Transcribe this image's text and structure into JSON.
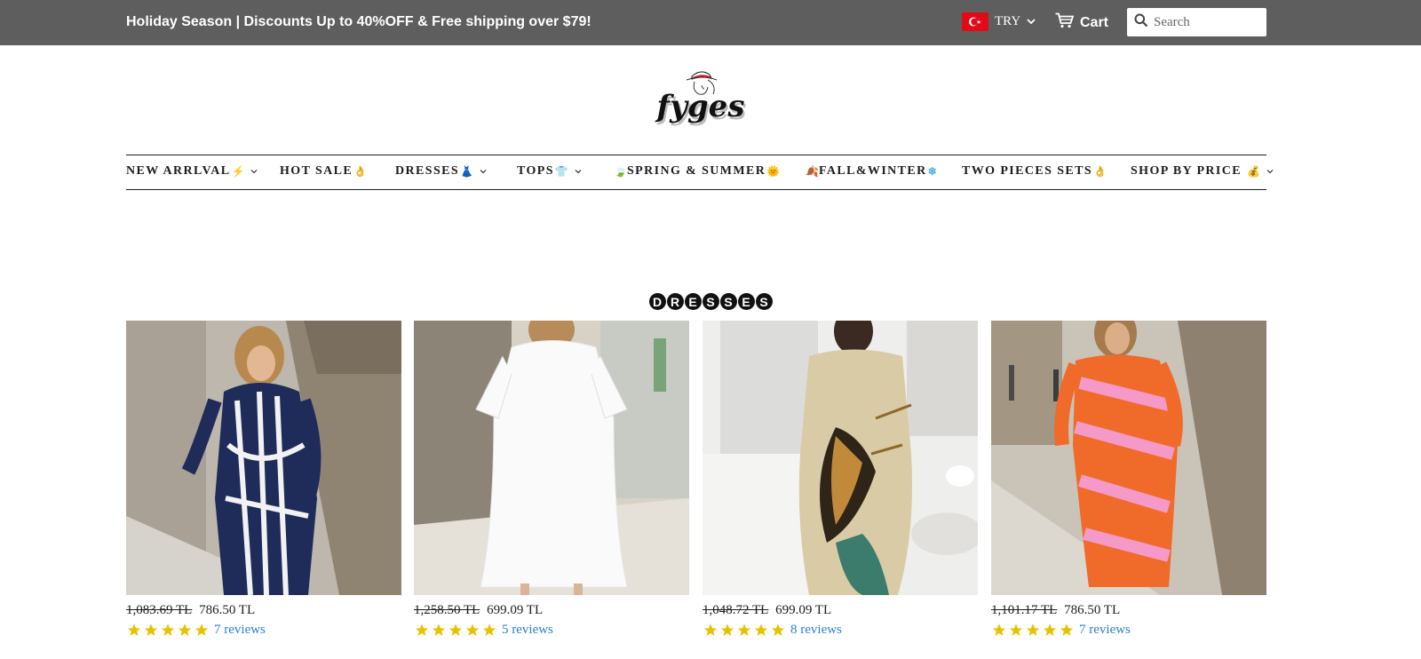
{
  "announcement": "Holiday Season | Discounts Up to 40%OFF & Free shipping over $79!",
  "currency": {
    "flag_icon": "turkey-flag-icon",
    "label": "TRY"
  },
  "cart": {
    "label": "Cart",
    "icon": "cart-icon"
  },
  "search": {
    "placeholder": "Search",
    "icon": "search-icon"
  },
  "logo": {
    "text": "fyges"
  },
  "nav": [
    {
      "label": "NEW ARRLVAL",
      "emoji": "⚡",
      "has_dropdown": true
    },
    {
      "label": "HOT SALE",
      "emoji": "👌",
      "has_dropdown": false
    },
    {
      "label": "DRESSES",
      "emoji": "👗",
      "has_dropdown": true
    },
    {
      "label": "TOPS",
      "emoji": "👕",
      "has_dropdown": true
    },
    {
      "label": "SPRING & SUMMER",
      "prefix": "🍃",
      "emoji": "🌞",
      "has_dropdown": false
    },
    {
      "label": "FALL&WINTER",
      "prefix": "🍂",
      "emoji": "❄",
      "has_dropdown": false
    },
    {
      "label": "TWO PIECES SETS",
      "emoji": "👌",
      "has_dropdown": false
    },
    {
      "label": "SHOP BY PRICE",
      "emoji": "💰",
      "has_dropdown": true
    }
  ],
  "section": {
    "title": "DRESSES",
    "letters": [
      "D",
      "R",
      "E",
      "S",
      "S",
      "E",
      "S"
    ]
  },
  "products": [
    {
      "old_price": "1,083.69 TL",
      "price": "786.50 TL",
      "rating": 5,
      "reviews": "7 reviews"
    },
    {
      "old_price": "1,258.50 TL",
      "price": "699.09 TL",
      "rating": 5,
      "reviews": "5 reviews"
    },
    {
      "old_price": "1,048.72 TL",
      "price": "699.09 TL",
      "rating": 5,
      "reviews": "8 reviews"
    },
    {
      "old_price": "1,101.17 TL",
      "price": "786.50 TL",
      "rating": 5,
      "reviews": "7 reviews"
    }
  ],
  "colors": {
    "topbar": "#5e5e5e",
    "star": "#e6c200",
    "link": "#2a7fd0",
    "flag": "#e30a17"
  }
}
